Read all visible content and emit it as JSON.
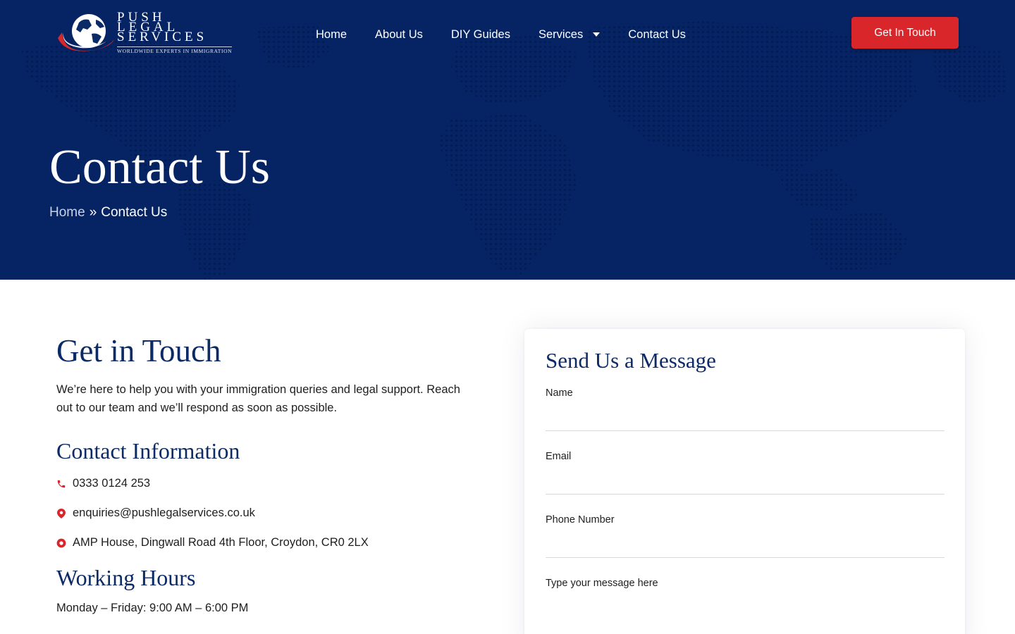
{
  "brand": {
    "logo_line1": "PUSH",
    "logo_line2": "LEGAL",
    "logo_line3": "SERVICES",
    "logo_tagline": "WORLDWIDE EXPERTS IN IMMIGRATION"
  },
  "nav": {
    "items": [
      {
        "label": "Home"
      },
      {
        "label": "About Us"
      },
      {
        "label": "DIY Guides"
      },
      {
        "label": "Services",
        "has_dropdown": true
      },
      {
        "label": "Contact Us"
      }
    ],
    "cta_label": "Get In Touch"
  },
  "hero": {
    "title": "Contact Us",
    "breadcrumb": {
      "home": "Home",
      "separator": "»",
      "current": "Contact Us"
    }
  },
  "contact": {
    "title": "Get in Touch",
    "intro": "We’re here to help you with your immigration queries and legal support. Reach out to our team and we’ll respond as soon as possible.",
    "info_title": "Contact Information",
    "phone": "0333 0124 253",
    "email": "enquiries@pushlegalservices.co.uk",
    "address": "AMP House, Dingwall Road 4th Floor, Croydon, CR0 2LX",
    "hours_title": "Working Hours",
    "hours": "Monday – Friday: 9:00 AM – 6:00 PM"
  },
  "form": {
    "title": "Send Us a Message",
    "fields": [
      {
        "label": "Name",
        "value": ""
      },
      {
        "label": "Email",
        "value": ""
      },
      {
        "label": "Phone Number",
        "value": ""
      },
      {
        "label": "Type your message here",
        "value": ""
      }
    ]
  },
  "colors": {
    "hero_bg": "#062463",
    "heading": "#0b2a66",
    "accent_red": "#d9262b",
    "breadcrumb_link": "#c7d2e8"
  },
  "icons": {
    "phone": "phone-icon",
    "email": "map-pin-icon",
    "address": "location-circle-icon",
    "services_caret": "caret-down-icon"
  }
}
